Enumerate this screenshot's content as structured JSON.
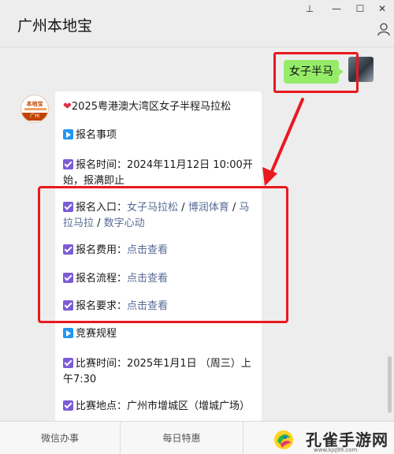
{
  "header": {
    "title": "广州本地宝"
  },
  "window": {
    "pin": "⊥",
    "minimize": "—",
    "maximize": "☐",
    "close": "✕"
  },
  "chat": {
    "outgoing": "女子半马",
    "bubble": {
      "title": "2025粤港澳大湾区女子半程马拉松",
      "section1": "报名事项",
      "time_line1": "报名时间：2024年11月12日 10:00开",
      "time_line2": "始，报满即止",
      "entry_label": "报名入口：",
      "entry_links": [
        "女子马拉松",
        "博润体育",
        "马拉马拉",
        "数字心动"
      ],
      "entry_link3_part1": "马",
      "entry_link3_part2": "拉马拉",
      "sep": " / ",
      "fee_label": "报名费用：",
      "process_label": "报名流程：",
      "req_label": "报名要求：",
      "view_link": "点击查看",
      "section2": "竞赛规程",
      "race_time_line1": "比赛时间：2025年1月1日 （周三）上",
      "race_time_line2": "午7:30",
      "venue": "比赛地点：广州市增城区（增城广场）"
    }
  },
  "avatar": {
    "top": "本地宝",
    "bottom": "广州"
  },
  "bottombar": {
    "tabs": [
      "微信办事",
      "每日特惠"
    ]
  },
  "watermark": {
    "text": "孔雀手游网",
    "url": "www.kjq99.com"
  },
  "colors": {
    "accent_red": "#e8191f",
    "link": "#576b95",
    "bubble_green": "#95ec69",
    "check_purple": "#7b5cd6"
  }
}
